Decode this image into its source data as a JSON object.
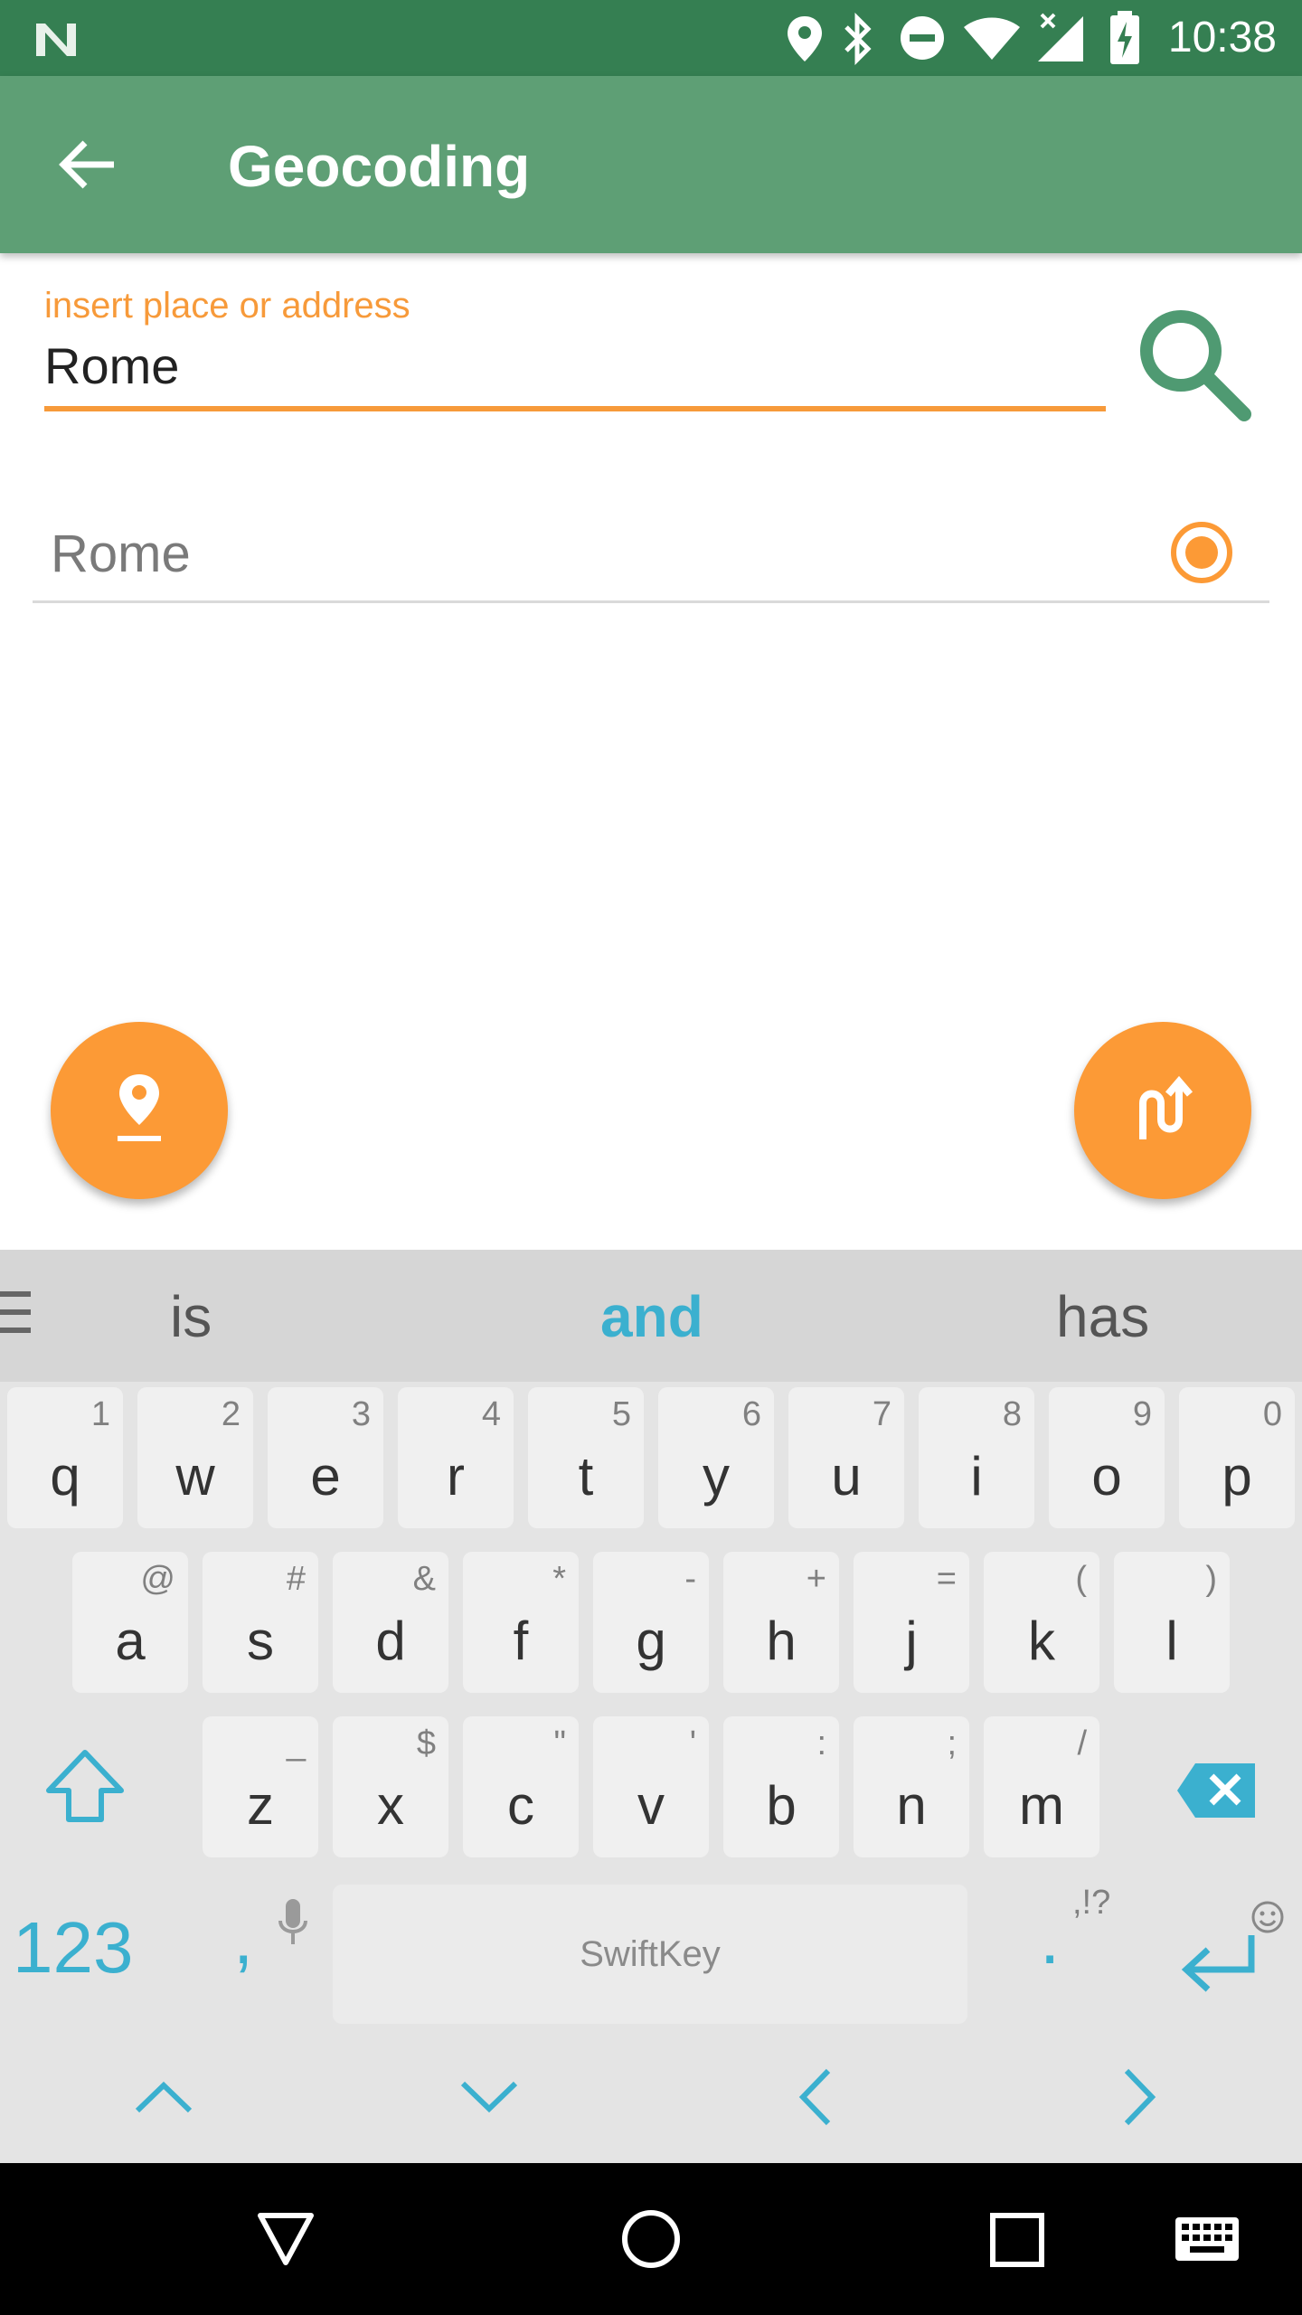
{
  "status_bar": {
    "time": "10:38",
    "icons": [
      "notification-n-icon",
      "location-icon",
      "bluetooth-icon",
      "do-not-disturb-icon",
      "wifi-icon",
      "signal-icon",
      "battery-charging-icon"
    ]
  },
  "toolbar": {
    "title": "Geocoding",
    "back_icon": "arrow-back-icon"
  },
  "search": {
    "label": "insert place or address",
    "value": "Rome",
    "accent_color": "#f79a3a",
    "button_icon": "search-icon"
  },
  "results": [
    {
      "label": "Rome",
      "selected": true
    }
  ],
  "fabs": {
    "left_icon": "place-marker-icon",
    "right_icon": "route-icon"
  },
  "keyboard": {
    "suggestions": [
      "is",
      "and",
      "has"
    ],
    "row1": [
      {
        "k": "q",
        "h": "1"
      },
      {
        "k": "w",
        "h": "2"
      },
      {
        "k": "e",
        "h": "3"
      },
      {
        "k": "r",
        "h": "4"
      },
      {
        "k": "t",
        "h": "5"
      },
      {
        "k": "y",
        "h": "6"
      },
      {
        "k": "u",
        "h": "7"
      },
      {
        "k": "i",
        "h": "8"
      },
      {
        "k": "o",
        "h": "9"
      },
      {
        "k": "p",
        "h": "0"
      }
    ],
    "row2": [
      {
        "k": "a",
        "h": "@"
      },
      {
        "k": "s",
        "h": "#"
      },
      {
        "k": "d",
        "h": "&"
      },
      {
        "k": "f",
        "h": "*"
      },
      {
        "k": "g",
        "h": "-"
      },
      {
        "k": "h",
        "h": "+"
      },
      {
        "k": "j",
        "h": "="
      },
      {
        "k": "k",
        "h": "("
      },
      {
        "k": "l",
        "h": ")"
      }
    ],
    "row3": [
      {
        "k": "z",
        "h": "_"
      },
      {
        "k": "x",
        "h": "$"
      },
      {
        "k": "c",
        "h": "\""
      },
      {
        "k": "v",
        "h": "'"
      },
      {
        "k": "b",
        "h": ":"
      },
      {
        "k": "n",
        "h": ";"
      },
      {
        "k": "m",
        "h": "/"
      }
    ],
    "numbers_key": "123",
    "comma_key": ",",
    "space_brand": "SwiftKey",
    "period_key": ".",
    "period_hint": ",!?",
    "accent_color": "#3bb0cf"
  },
  "nav_bar": {
    "icons": [
      "back-triangle-icon",
      "home-circle-icon",
      "recents-square-icon",
      "keyboard-icon"
    ]
  }
}
